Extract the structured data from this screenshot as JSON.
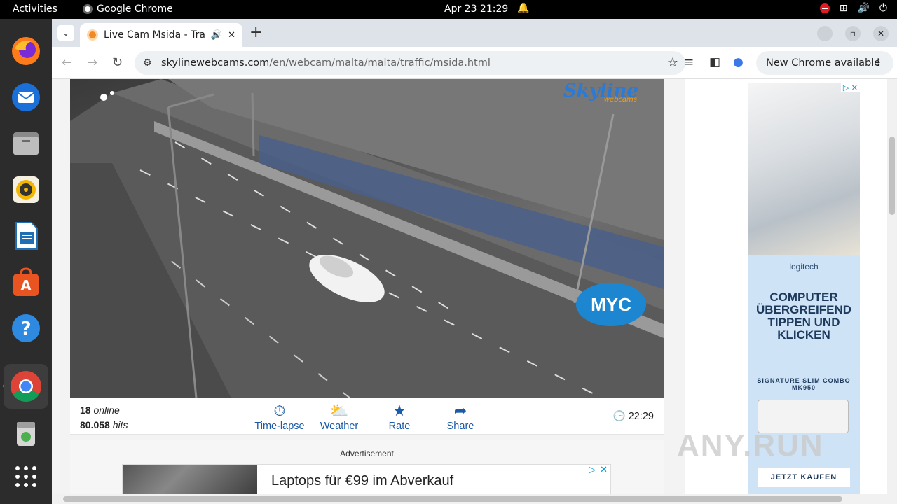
{
  "topbar": {
    "activities": "Activities",
    "app_name": "Google Chrome",
    "clock": "Apr 23  21:29"
  },
  "dock": {
    "items": [
      "firefox-icon",
      "thunderbird-icon",
      "files-icon",
      "rhythmbox-icon",
      "writer-icon",
      "app-center-icon",
      "help-icon",
      "chrome-icon",
      "trash-icon",
      "show-apps-icon"
    ]
  },
  "browser": {
    "tab_title": "Live Cam Msida - Traffic",
    "url_domain": "skylinewebcams.com",
    "url_path": "/en/webcam/malta/malta/traffic/msida.html",
    "update_label": "New Chrome available"
  },
  "camera": {
    "logo": "Skyline",
    "logo_sub": "webcams",
    "overlay_logo": "MYC"
  },
  "info": {
    "online_count": "18",
    "online_label": "online",
    "hits_count": "80.058",
    "hits_label": "hits",
    "actions": [
      {
        "label": "Time-lapse",
        "icon": "timelapse-icon"
      },
      {
        "label": "Weather",
        "icon": "weather-icon"
      },
      {
        "label": "Rate",
        "icon": "star-icon"
      },
      {
        "label": "Share",
        "icon": "share-icon"
      }
    ],
    "local_time": "22:29"
  },
  "ad": {
    "label": "Advertisement",
    "headline": "Laptops für €99 im Abverkauf"
  },
  "side_ad": {
    "brand": "logitech",
    "headline": "COMPUTER ÜBERGREIFEND TIPPEN UND KLICKEN",
    "model": "SIGNATURE SLIM COMBO MK950",
    "cta": "JETZT KAUFEN"
  },
  "watermark": "ANY.RUN"
}
